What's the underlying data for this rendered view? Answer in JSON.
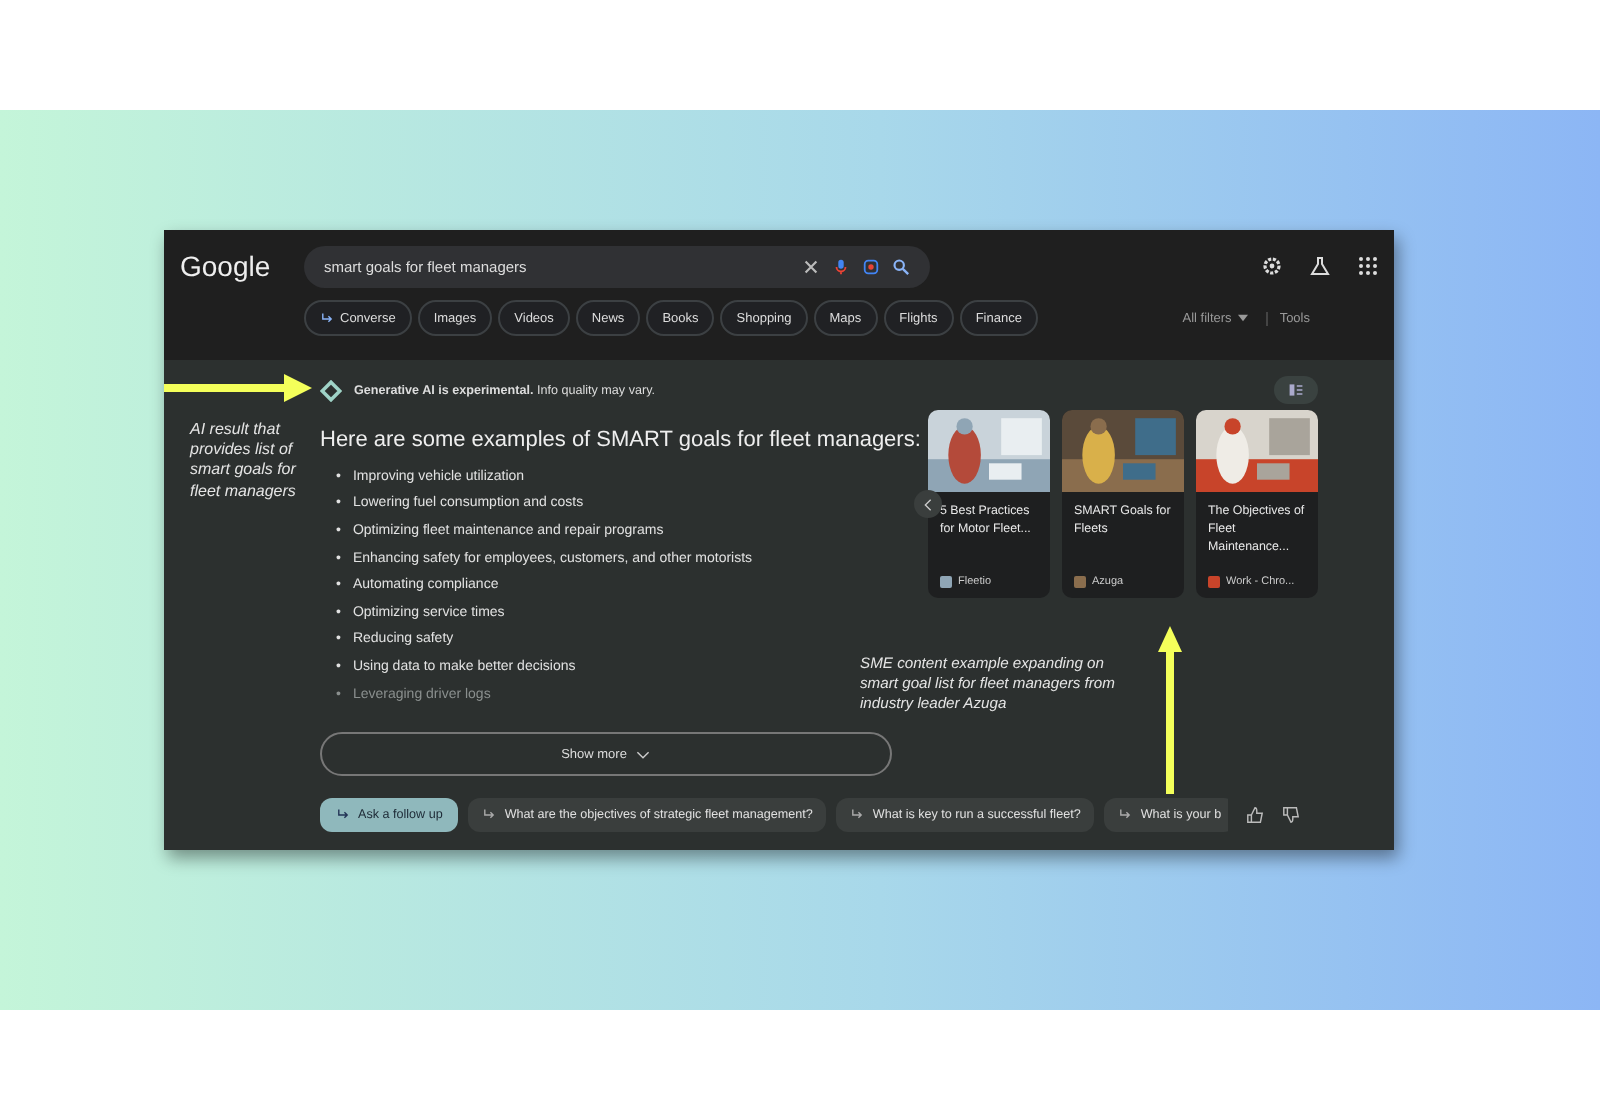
{
  "header": {
    "logo": "Google",
    "search": {
      "value": "smart goals for fleet managers"
    },
    "chips": [
      {
        "label": "Converse",
        "kind": "converse"
      },
      {
        "label": "Images",
        "kind": "plain"
      },
      {
        "label": "Videos",
        "kind": "plain"
      },
      {
        "label": "News",
        "kind": "plain"
      },
      {
        "label": "Books",
        "kind": "plain"
      },
      {
        "label": "Shopping",
        "kind": "plain"
      },
      {
        "label": "Maps",
        "kind": "plain"
      },
      {
        "label": "Flights",
        "kind": "plain"
      },
      {
        "label": "Finance",
        "kind": "plain"
      }
    ],
    "all_filters": "All filters",
    "tools": "Tools"
  },
  "ai_result": {
    "notice": "**Generative AI is experimental.** Info quality may vary.",
    "heading": "Here are some examples of SMART goals for fleet managers:",
    "items": [
      {
        "marker": "•",
        "text": "Improving vehicle utilization",
        "faded": false
      },
      {
        "marker": "•",
        "text": "Lowering fuel consumption and costs",
        "faded": false
      },
      {
        "marker": "•",
        "text": "Optimizing fleet maintenance and repair programs",
        "faded": false
      },
      {
        "marker": "•",
        "text": "Enhancing safety for employees, customers, and other motorists",
        "faded": false
      },
      {
        "marker": "•",
        "text": "Automating compliance",
        "faded": false
      },
      {
        "marker": "•",
        "text": "Optimizing service times",
        "faded": false
      },
      {
        "marker": "•",
        "text": "Reducing safety",
        "faded": false
      },
      {
        "marker": "•",
        "text": "Using data to make better decisions",
        "faded": false
      },
      {
        "marker": "•",
        "text": "Leveraging driver logs",
        "faded": true
      }
    ],
    "show_more": "Show more",
    "sources": [
      {
        "title": "5 Best Practices for Motor Fleet...",
        "site": "Fleetio",
        "kind": "office"
      },
      {
        "title": "SMART Goals for Fleets",
        "site": "Azuga",
        "kind": "warehouse"
      },
      {
        "title": "The Objectives of Fleet Maintenance...",
        "site": "Work - Chro...",
        "kind": "machine"
      }
    ],
    "follow_up": "Ask a follow up",
    "suggestions": [
      "What are the objectives of strategic fleet management?",
      "What is key to run a successful fleet?",
      "What is your b"
    ]
  },
  "annotations": {
    "left": "AI result that provides list of smart goals for fleet managers",
    "right": "SME content example expanding on smart goal list for fleet managers from industry leader Azuga"
  }
}
